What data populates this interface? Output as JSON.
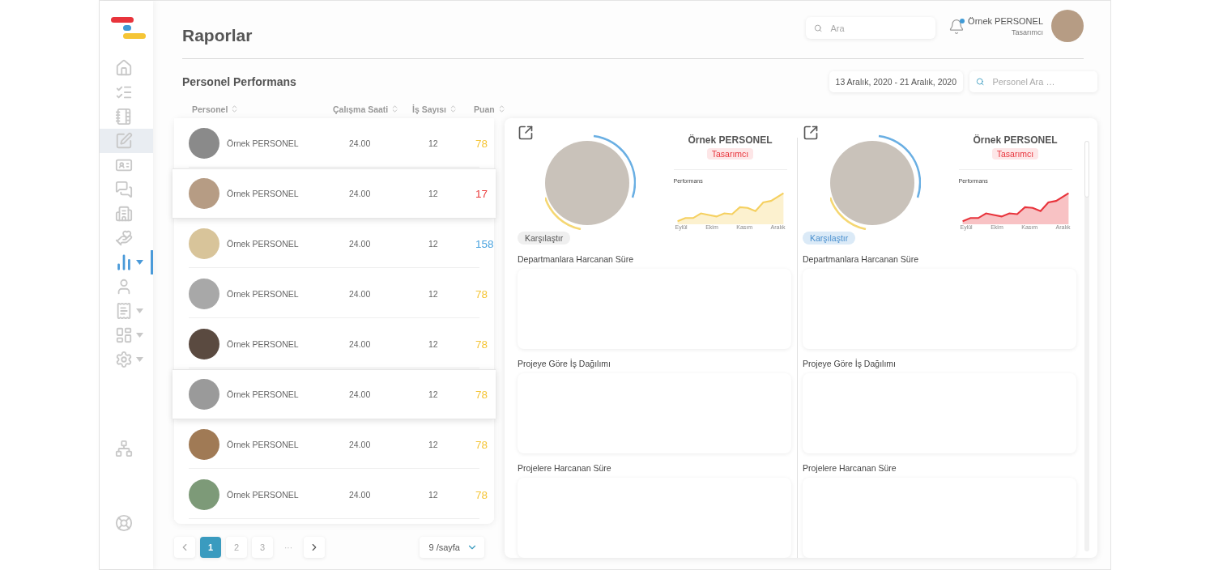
{
  "header": {
    "title": "Raporlar",
    "search": {
      "placeholder": "Ara"
    },
    "user": {
      "name": "Örnek PERSONEL",
      "role": "Tasarımcı",
      "has_notification": true
    }
  },
  "sidebar": {
    "items": [
      {
        "kind": "home",
        "selected": false,
        "highlighted": false,
        "has_submenu": false
      },
      {
        "kind": "tasks",
        "selected": false,
        "highlighted": false,
        "has_submenu": false
      },
      {
        "kind": "notebook",
        "selected": false,
        "highlighted": false,
        "has_submenu": false
      },
      {
        "kind": "edit",
        "selected": false,
        "highlighted": true,
        "has_submenu": false
      },
      {
        "kind": "idcard",
        "selected": false,
        "highlighted": false,
        "has_submenu": false
      },
      {
        "kind": "chat",
        "selected": false,
        "highlighted": false,
        "has_submenu": false
      },
      {
        "kind": "buildings",
        "selected": false,
        "highlighted": false,
        "has_submenu": false
      },
      {
        "kind": "hands",
        "selected": false,
        "highlighted": false,
        "has_submenu": false
      },
      {
        "kind": "reports",
        "selected": true,
        "highlighted": false,
        "has_submenu": true
      },
      {
        "kind": "user",
        "selected": false,
        "highlighted": false,
        "has_submenu": false
      },
      {
        "kind": "receipt",
        "selected": false,
        "highlighted": false,
        "has_submenu": true
      },
      {
        "kind": "dashboard",
        "selected": false,
        "highlighted": false,
        "has_submenu": true
      },
      {
        "kind": "settings",
        "selected": false,
        "highlighted": false,
        "has_submenu": true
      }
    ],
    "bottom_items": [
      {
        "kind": "network",
        "selected": false
      },
      {
        "kind": "support",
        "selected": false
      }
    ]
  },
  "section": {
    "title": "Personel Performans",
    "date_range": "13 Aralık, 2020 - 21 Aralık, 2020",
    "search": {
      "placeholder": "Personel Ara …"
    }
  },
  "table": {
    "columns": [
      "Personel",
      "Çalışma Saati",
      "İş Sayısı",
      "Puan"
    ],
    "rows": [
      {
        "name": "Örnek PERSONEL",
        "hours": "24.00",
        "jobs": "12",
        "score": "78",
        "color": "#f5c536",
        "selected": false
      },
      {
        "name": "Örnek PERSONEL",
        "hours": "24.00",
        "jobs": "12",
        "score": "17",
        "color": "#ea3b3b",
        "selected": true
      },
      {
        "name": "Örnek PERSONEL",
        "hours": "24.00",
        "jobs": "12",
        "score": "158",
        "color": "#4aa3df",
        "selected": false
      },
      {
        "name": "Örnek PERSONEL",
        "hours": "24.00",
        "jobs": "12",
        "score": "78",
        "color": "#f5c536",
        "selected": false
      },
      {
        "name": "Örnek PERSONEL",
        "hours": "24.00",
        "jobs": "12",
        "score": "78",
        "color": "#f5c536",
        "selected": false
      },
      {
        "name": "Örnek PERSONEL",
        "hours": "24.00",
        "jobs": "12",
        "score": "78",
        "color": "#f5c536",
        "selected": true
      },
      {
        "name": "Örnek PERSONEL",
        "hours": "24.00",
        "jobs": "12",
        "score": "78",
        "color": "#f5c536",
        "selected": false
      },
      {
        "name": "Örnek PERSONEL",
        "hours": "24.00",
        "jobs": "12",
        "score": "78",
        "color": "#f5c536",
        "selected": false
      }
    ]
  },
  "pagination": {
    "pages": [
      {
        "label": "1",
        "selected": true
      },
      {
        "label": "2",
        "selected": false
      },
      {
        "label": "3",
        "selected": false
      }
    ],
    "ellipsis": "···",
    "page_size": "9 /sayfa"
  },
  "comparison": {
    "cards": [
      {
        "name": "Örnek PERSONEL",
        "role": "Tasarımcı",
        "chart_label": "Performans",
        "months": [
          "Eylül",
          "Ekim",
          "Kasım",
          "Aralık"
        ],
        "color": "#f5d060",
        "compare_button": "Karşılaştır",
        "compare_selected": false,
        "sections": [
          "Departmanlara Harcanan Süre",
          "Projeye Göre İş Dağılımı",
          "Projelere Harcanan Süre"
        ]
      },
      {
        "name": "Örnek PERSONEL",
        "role": "Tasarımcı",
        "chart_label": "Performans",
        "months": [
          "Eylül",
          "Ekim",
          "Kasım",
          "Aralık"
        ],
        "color": "#e8343c",
        "compare_button": "Karşılaştır",
        "compare_selected": true,
        "sections": [
          "Departmanlara Harcanan Süre",
          "Projeye Göre İş Dağılımı",
          "Projelere Harcanan Süre"
        ]
      }
    ]
  }
}
